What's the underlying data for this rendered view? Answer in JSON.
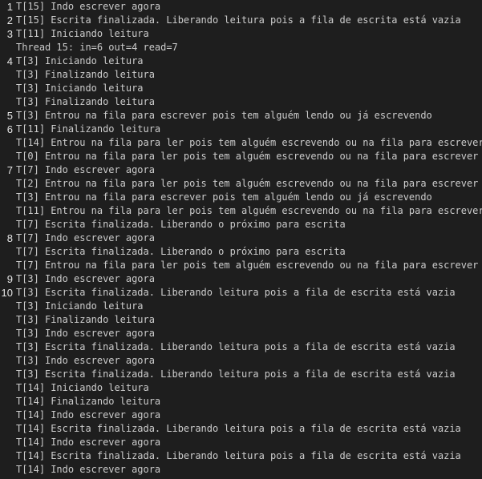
{
  "terminal": {
    "lines": [
      {
        "num": "1",
        "text": "T[15] Indo escrever agora"
      },
      {
        "num": "2",
        "text": "T[15] Escrita finalizada. Liberando leitura pois a fila de escrita está vazia"
      },
      {
        "num": "3",
        "text": "T[11] Iniciando leitura"
      },
      {
        "num": "",
        "text": "Thread 15: in=6 out=4 read=7"
      },
      {
        "num": "4",
        "text": "T[3] Iniciando leitura"
      },
      {
        "num": "",
        "text": "T[3] Finalizando leitura"
      },
      {
        "num": "",
        "text": "T[3] Iniciando leitura"
      },
      {
        "num": "",
        "text": "T[3] Finalizando leitura"
      },
      {
        "num": "5",
        "text": "T[3] Entrou na fila para escrever pois tem alguém lendo ou já escrevendo"
      },
      {
        "num": "6",
        "text": "T[11] Finalizando leitura"
      },
      {
        "num": "",
        "text": "T[14] Entrou na fila para ler pois tem alguém escrevendo ou na fila para escrever"
      },
      {
        "num": "",
        "text": "T[0] Entrou na fila para ler pois tem alguém escrevendo ou na fila para escrever"
      },
      {
        "num": "7",
        "text": "T[7] Indo escrever agora"
      },
      {
        "num": "",
        "text": "T[2] Entrou na fila para ler pois tem alguém escrevendo ou na fila para escrever"
      },
      {
        "num": "",
        "text": "T[3] Entrou na fila para escrever pois tem alguém lendo ou já escrevendo"
      },
      {
        "num": "",
        "text": "T[11] Entrou na fila para ler pois tem alguém escrevendo ou na fila para escrever"
      },
      {
        "num": "",
        "text": "T[7] Escrita finalizada. Liberando o próximo para escrita"
      },
      {
        "num": "8",
        "text": "T[7] Indo escrever agora"
      },
      {
        "num": "",
        "text": "T[7] Escrita finalizada. Liberando o próximo para escrita"
      },
      {
        "num": "",
        "text": "T[7] Entrou na fila para ler pois tem alguém escrevendo ou na fila para escrever"
      },
      {
        "num": "9",
        "text": "T[3] Indo escrever agora"
      },
      {
        "num": "10",
        "text": "T[3] Escrita finalizada. Liberando leitura pois a fila de escrita está vazia"
      },
      {
        "num": "",
        "text": "T[3] Iniciando leitura"
      },
      {
        "num": "",
        "text": "T[3] Finalizando leitura"
      },
      {
        "num": "",
        "text": "T[3] Indo escrever agora"
      },
      {
        "num": "",
        "text": "T[3] Escrita finalizada. Liberando leitura pois a fila de escrita está vazia"
      },
      {
        "num": "",
        "text": "T[3] Indo escrever agora"
      },
      {
        "num": "",
        "text": "T[3] Escrita finalizada. Liberando leitura pois a fila de escrita está vazia"
      },
      {
        "num": "",
        "text": "T[14] Iniciando leitura"
      },
      {
        "num": "",
        "text": "T[14] Finalizando leitura"
      },
      {
        "num": "",
        "text": "T[14] Indo escrever agora"
      },
      {
        "num": "",
        "text": "T[14] Escrita finalizada. Liberando leitura pois a fila de escrita está vazia"
      },
      {
        "num": "",
        "text": "T[14] Indo escrever agora"
      },
      {
        "num": "",
        "text": "T[14] Escrita finalizada. Liberando leitura pois a fila de escrita está vazia"
      },
      {
        "num": "",
        "text": "T[14] Indo escrever agora"
      }
    ]
  }
}
